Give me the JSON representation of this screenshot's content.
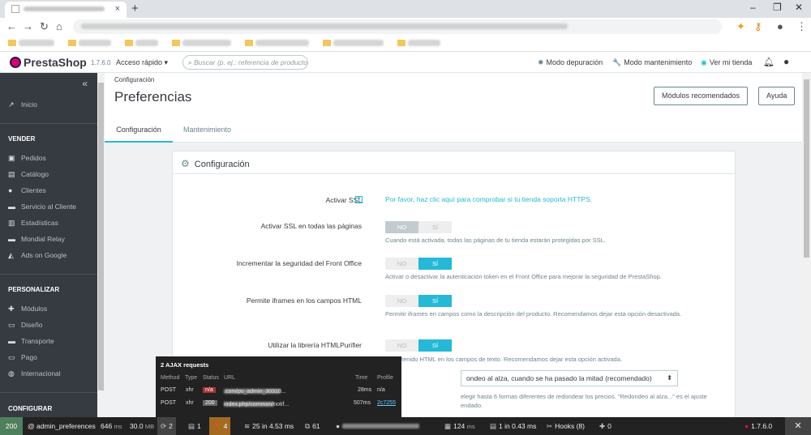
{
  "browser": {
    "tab_close": "×",
    "new_tab": "+",
    "win_min": "–",
    "win_max": "❐",
    "win_close": "✕",
    "back": "←",
    "forward": "→",
    "reload": "↻",
    "home": "⌂",
    "menu": "⋮"
  },
  "header": {
    "logo": "PrestaShop",
    "version": "1.7.6.0",
    "quick_access": "Acceso rápido ▾",
    "search_placeholder": "Buscar (p. ej.: referencia de producto, n",
    "debug_mode": "Modo depuración",
    "maintenance_mode": "Modo mantenimiento",
    "view_store": "Ver mi tienda"
  },
  "sidebar": {
    "collapse": "«",
    "inicio": "Inicio",
    "vender": "VENDER",
    "vender_items": [
      "Pedidos",
      "Catálogo",
      "Clientes",
      "Servicio al Cliente",
      "Estadísticas",
      "Mondial Relay",
      "Ads on Google"
    ],
    "personalizar": "PERSONALIZAR",
    "personalizar_items": [
      "Módulos",
      "Diseño",
      "Transporte",
      "Pago",
      "Internacional"
    ],
    "configurar": "CONFIGURAR"
  },
  "toolbar": {
    "breadcrumb": "Configuración",
    "title": "Preferencias",
    "recommended_modules": "Módulos recomendados",
    "help": "Ayuda",
    "tabs": [
      "Configuración",
      "Mantenimiento"
    ]
  },
  "card": {
    "title": "Configuración",
    "ssl_label": "Activar SSL",
    "ssl_help_icon": "?",
    "ssl_link": "Por favor, haz clic aquí para comprobar si tu tienda soporta HTTPS.",
    "ssl_all_label": "Activar SSL en todas las páginas",
    "ssl_all_help": "Cuando está activada, todas las páginas de tu tienda estarán protegidas por SSL.",
    "security_label": "Incrementar la seguridad del Front Office",
    "security_help": "Activar o desactivar la autenticación token en el Front Office para mejorar la seguridad de PrestaShop.",
    "iframes_label": "Permite iframes en los campos HTML",
    "iframes_help": "Permitir iframes en campos como la descripción del producto. Recomendamos dejar esta opción desactivada.",
    "purifier_label": "Utilizar la librería HTMLPurifier",
    "purifier_help": "el contenido HTML en los campos de texto. Recomendamos dejar esta opción activada.",
    "round_select": "ondeo al alza, cuando se ha pasado la mitad (recomendado)",
    "round_help": "elegir hasta 6 formas diferentes de redondear los precios. \"Redondeo al alza...\" es el ajuste",
    "round_help2": "endado.",
    "switch_no": "NO",
    "switch_si": "SÍ"
  },
  "ajax": {
    "title": "2 AJAX requests",
    "headers": [
      "Method",
      "Type",
      "Status",
      "URL",
      "Time",
      "Profile"
    ],
    "rows": [
      {
        "method": "POST",
        "type": "xhr",
        "status": "n/a",
        "url": ".com/ps_admin_30310...",
        "time": "28ms",
        "profile": "n/a"
      },
      {
        "method": "POST",
        "type": "xhr",
        "status": "200",
        "url": "index.php/common/notif...",
        "time": "507ms",
        "profile": "2c7255"
      }
    ]
  },
  "debugbar": {
    "status": "200",
    "route": "@ admin_preferences",
    "time": "646",
    "time_unit": "ms",
    "memory": "30.0",
    "memory_unit": "MB",
    "ajax_count": "2",
    "config_count": "1",
    "warnings": "4",
    "queries": "25",
    "queries_time": "in 4.53 ms",
    "objects": "61",
    "ms1": "124",
    "ms1_unit": "ms",
    "db_count": "1",
    "db_time": "in 0.43 ms",
    "hooks": "Hooks (8)",
    "modules": "0",
    "version": "1.7.6.0",
    "close": "✕"
  },
  "colors": {
    "accent": "#25b9d7",
    "sidebar": "#363a41",
    "debug_green": "#4f805d",
    "debug_orange": "#a46a1f"
  }
}
